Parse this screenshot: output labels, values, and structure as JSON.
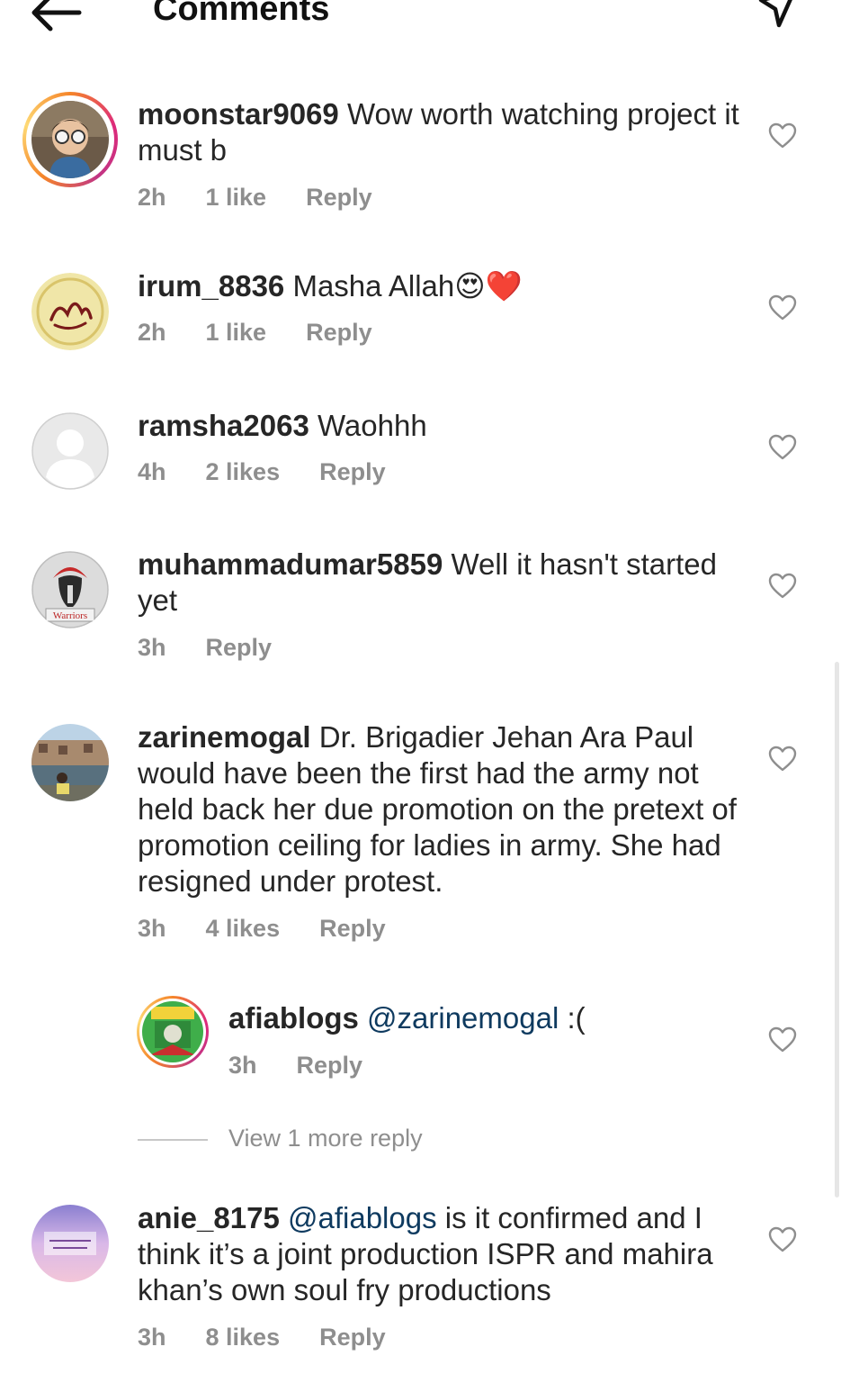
{
  "header": {
    "title": "Comments"
  },
  "comments": [
    {
      "username": "moonstar9069",
      "text": "Wow worth watching project it must b",
      "time": "2h",
      "likes": "1 like",
      "reply": "Reply"
    },
    {
      "username": "irum_8836",
      "text": "Masha Allah😍❤️",
      "time": "2h",
      "likes": "1 like",
      "reply": "Reply"
    },
    {
      "username": "ramsha2063",
      "text": "Waohhh",
      "time": "4h",
      "likes": "2 likes",
      "reply": "Reply"
    },
    {
      "username": "muhammadumar5859",
      "text": "Well it hasn't started yet",
      "time": "3h",
      "reply": "Reply",
      "avatar_text": "Warriors"
    },
    {
      "username": "zarinemogal",
      "text": "Dr. Brigadier Jehan Ara Paul would have been the first had the army not held back her due promotion on the pretext of promotion ceiling for ladies in army. She had resigned under protest.",
      "time": "3h",
      "likes": "4 likes",
      "reply": "Reply"
    },
    {
      "username": "anie_8175",
      "mention": "@afiablogs",
      "text": " is it confirmed and I think it’s a  joint production ISPR and mahira khan’s own soul fry productions",
      "time": "3h",
      "likes": "8 likes",
      "reply": "Reply"
    }
  ],
  "reply": {
    "username": "afiablogs",
    "mention": "@zarinemogal",
    "text": " :(",
    "time": "3h",
    "reply": "Reply"
  },
  "view_more": "View 1 more reply",
  "colors": {
    "text": "#262626",
    "meta": "#8e8e8e",
    "mention": "#0e3a5f",
    "ring_start": "#f58529",
    "ring_end": "#dd2a7b"
  }
}
